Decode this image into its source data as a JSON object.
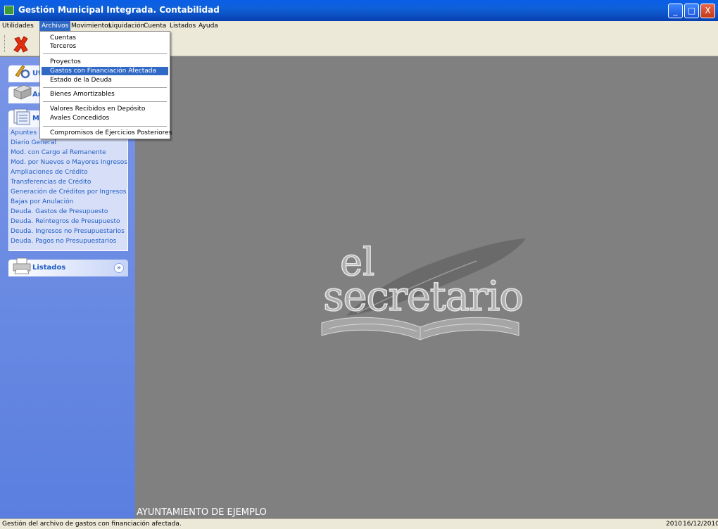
{
  "window": {
    "title": "Gestión Municipal Integrada. Contabilidad",
    "minimize": "_",
    "maximize": "□",
    "close": "X"
  },
  "menubar": [
    "Utilidades",
    "Archivos",
    "Movimientos",
    "Liquidación",
    "Cuenta",
    "Listados",
    "Ayuda"
  ],
  "dropdown": {
    "items": [
      "Cuentas",
      "Terceros",
      "Proyectos",
      "Gastos con Financiación Afectada",
      "Estado de la Deuda",
      "Bienes Amortizables",
      "Valores Recibidos en Depósito",
      "Avales Concedidos",
      "Compromisos de Ejercicios Posteriores"
    ]
  },
  "sidebar": {
    "sections": [
      {
        "label": "Ut"
      },
      {
        "label": "Ar"
      },
      {
        "label": "M"
      },
      {
        "label": "Listados"
      }
    ],
    "links": [
      "Apuntes",
      "Diario General",
      "Mod. con Cargo al Remanente",
      "Mod. por Nuevos o Mayores Ingresos",
      "Ampliaciones de Crédito",
      "Transferencias de Crédito",
      "Generación de Créditos por Ingresos",
      "Bajas por Anulación",
      "Deuda. Gastos de Presupuesto",
      "Deuda. Reintegros de Presupuesto",
      "Deuda. Ingresos no Presupuestarios",
      "Deuda. Pagos no Presupuestarios"
    ],
    "collapse_glyph": "»"
  },
  "main": {
    "logo_line1": "el",
    "logo_line2": "secretario",
    "footer_text": "AYUNTAMIENTO DE EJEMPLO"
  },
  "statusbar": {
    "message": "Gestión del archivo de gastos con financiación afectada.",
    "year": "2010",
    "date": "16/12/2010"
  },
  "colors": {
    "titlebar": "#0a5ee8",
    "menu_highlight": "#316ac5",
    "sidebar": "#6d8ae3",
    "main_bg": "#808080",
    "link": "#215dc6"
  }
}
